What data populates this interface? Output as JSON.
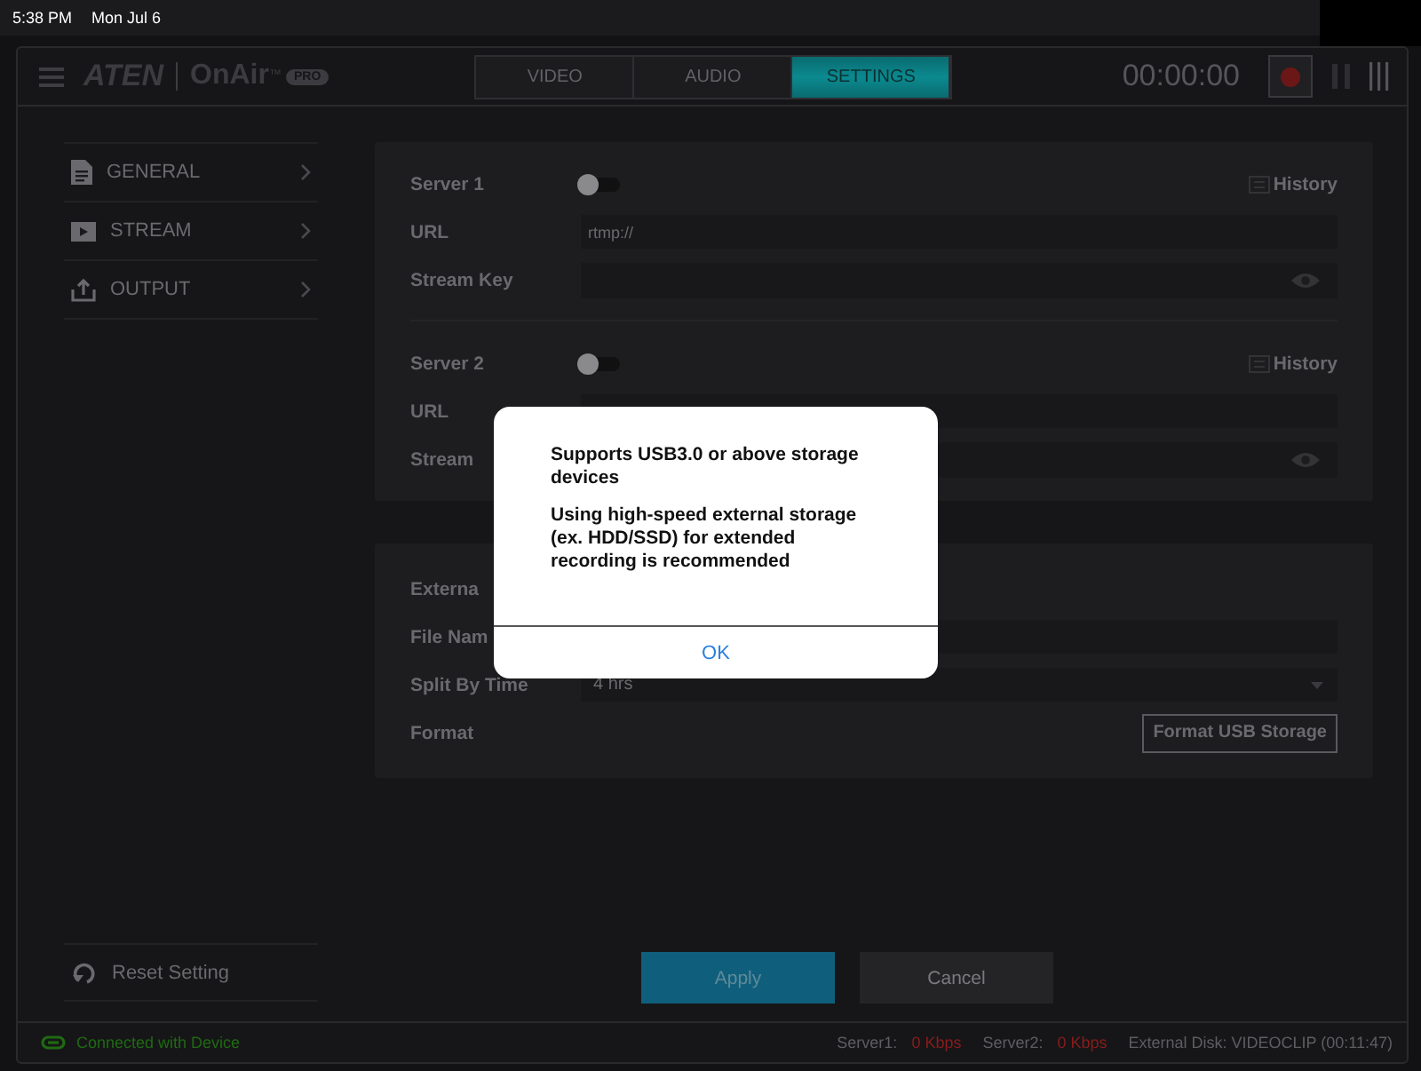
{
  "status_bar": {
    "time": "5:38 PM",
    "date": "Mon Jul 6"
  },
  "header": {
    "brand": "ATEN",
    "product": "OnAir",
    "trademark": "™",
    "badge": "PRO",
    "timer": "00:00:00"
  },
  "tabs": [
    {
      "label": "VIDEO",
      "selected": false
    },
    {
      "label": "AUDIO",
      "selected": false
    },
    {
      "label": "SETTINGS",
      "selected": true
    }
  ],
  "sidebar": {
    "items": [
      {
        "label": "GENERAL",
        "kind": "document",
        "selected": false
      },
      {
        "label": "STREAM",
        "kind": "play",
        "selected": false
      },
      {
        "label": "OUTPUT",
        "kind": "upload",
        "selected": false
      }
    ],
    "reset": "Reset Setting"
  },
  "servers": [
    {
      "label": "Server 1",
      "on": false,
      "history": "History",
      "url_label": "URL",
      "url_placeholder": "rtmp://",
      "key_label": "Stream Key"
    },
    {
      "label": "Server 2",
      "on": false,
      "history": "History",
      "url_label": "URL",
      "key_label": "Stream"
    }
  ],
  "external": {
    "title": "Externa",
    "file_label": "File Nam",
    "split_label": "Split By Time",
    "split_value": "4 hrs",
    "format_label": "Format",
    "format_button": "Format USB Storage"
  },
  "buttons": {
    "apply": "Apply",
    "cancel": "Cancel"
  },
  "footer": {
    "connection": "Connected with Device",
    "server1_label": "Server1:",
    "server1_value": "0 Kbps",
    "server2_label": "Server2:",
    "server2_value": "0 Kbps",
    "disk": "External Disk: VIDEOCLIP (00:11:47)"
  },
  "dialog": {
    "title": "Supports USB3.0 or above storage devices",
    "message": "Using high-speed external storage (ex. HDD/SSD) for extended recording is recommended",
    "ok": "OK"
  }
}
